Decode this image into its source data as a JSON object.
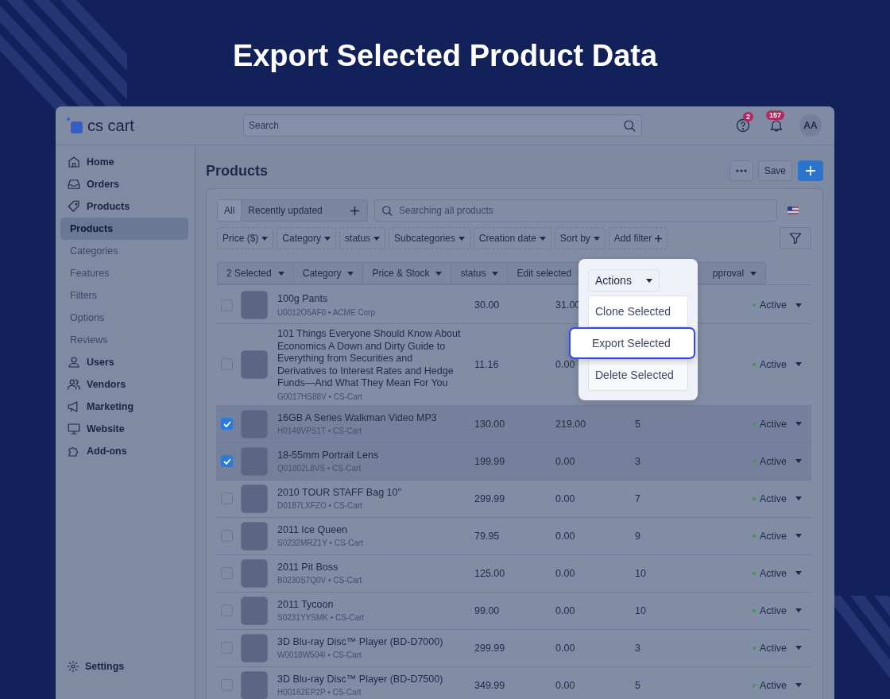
{
  "headline": "Export Selected Product Data",
  "header": {
    "logo": "cs cart",
    "search": {
      "placeholder": "Search"
    },
    "help_badge": "2",
    "notifications_badge": "157",
    "avatar": "AA"
  },
  "sidebar": {
    "items": [
      {
        "label": "Home",
        "kind": "section",
        "selected": false
      },
      {
        "label": "Orders",
        "kind": "section",
        "selected": false
      },
      {
        "label": "Products",
        "kind": "section",
        "selected": false
      },
      {
        "label": "Products",
        "kind": "sub",
        "selected": true
      },
      {
        "label": "Categories",
        "kind": "sub",
        "selected": false
      },
      {
        "label": "Features",
        "kind": "sub",
        "selected": false
      },
      {
        "label": "Filters",
        "kind": "sub",
        "selected": false
      },
      {
        "label": "Options",
        "kind": "sub",
        "selected": false
      },
      {
        "label": "Reviews",
        "kind": "sub",
        "selected": false
      },
      {
        "label": "Users",
        "kind": "section",
        "selected": false
      },
      {
        "label": "Vendors",
        "kind": "section",
        "selected": false
      },
      {
        "label": "Marketing",
        "kind": "section",
        "selected": false
      },
      {
        "label": "Website",
        "kind": "section",
        "selected": false
      },
      {
        "label": "Add-ons",
        "kind": "section",
        "selected": false
      }
    ],
    "settings": "Settings"
  },
  "page": {
    "title": "Products",
    "save_button": "Save",
    "tabs": [
      {
        "label": "All",
        "selected": true
      },
      {
        "label": "Recently updated",
        "selected": false
      }
    ],
    "product_search": {
      "placeholder": "Searching all products"
    },
    "filters": [
      "Price ($)",
      "Category",
      "status",
      "Subcategories",
      "Creation date",
      "Sort by"
    ],
    "add_filter": "Add filter",
    "bulk_actions": [
      "2 Selected",
      "Category",
      "Price & Stock",
      "status",
      "Edit selected",
      "pproval"
    ],
    "table": {
      "rows": [
        {
          "name": "100g Pants",
          "meta": "U0012O5AF0 • ACME Corp",
          "price": "30.00",
          "list_price": "31.00",
          "status": "Active",
          "selected": false
        },
        {
          "name": "101 Things Everyone Should Know About Economics A Down and Dirty Guide to Everything from Securities and Derivatives to Interest Rates and Hedge Funds—And What They Mean For You",
          "meta": "G0017HS88V • CS-Cart",
          "price": "11.16",
          "list_price": "0.00",
          "status": "Active",
          "selected": false
        },
        {
          "name": "16GB A Series Walkman Video MP3",
          "meta": "H0148VPS1T • CS-Cart",
          "price": "130.00",
          "list_price": "219.00",
          "quantity": "5",
          "status": "Active",
          "selected": true
        },
        {
          "name": "18-55mm Portrait Lens",
          "meta": "Q01802L8VS • CS-Cart",
          "price": "199.99",
          "list_price": "0.00",
          "quantity": "3",
          "status": "Active",
          "selected": true
        },
        {
          "name": "2010 TOUR STAFF Bag 10\"",
          "meta": "D0187LXFZO • CS-Cart",
          "price": "299.99",
          "list_price": "0.00",
          "quantity": "7",
          "status": "Active",
          "selected": false
        },
        {
          "name": "2011 Ice Queen",
          "meta": "S0232MRZ1Y • CS-Cart",
          "price": "79.95",
          "list_price": "0.00",
          "quantity": "9",
          "status": "Active",
          "selected": false
        },
        {
          "name": "2011 Pit Boss",
          "meta": "B0230S7Q0V • CS-Cart",
          "price": "125.00",
          "list_price": "0.00",
          "quantity": "10",
          "status": "Active",
          "selected": false
        },
        {
          "name": "2011 Tycoon",
          "meta": "S0231YYSMK • CS-Cart",
          "price": "99.00",
          "list_price": "0.00",
          "quantity": "10",
          "status": "Active",
          "selected": false
        },
        {
          "name": "3D Blu-ray Disc™ Player (BD-D7000)",
          "meta": "W0018W504I • CS-Cart",
          "price": "299.99",
          "list_price": "0.00",
          "quantity": "3",
          "status": "Active",
          "selected": false
        },
        {
          "name": "3D Blu-ray Disc™ Player (BD-D7500)",
          "meta": "H00162EP2P • CS-Cart",
          "price": "349.99",
          "list_price": "0.00",
          "quantity": "5",
          "status": "Active",
          "selected": false
        }
      ]
    },
    "actions_menu": {
      "label": "Actions",
      "items": [
        {
          "label": "Clone Selected",
          "selected": false
        },
        {
          "label": "Export Selected",
          "selected": true
        },
        {
          "label": "Delete Selected",
          "selected": false
        }
      ]
    }
  }
}
